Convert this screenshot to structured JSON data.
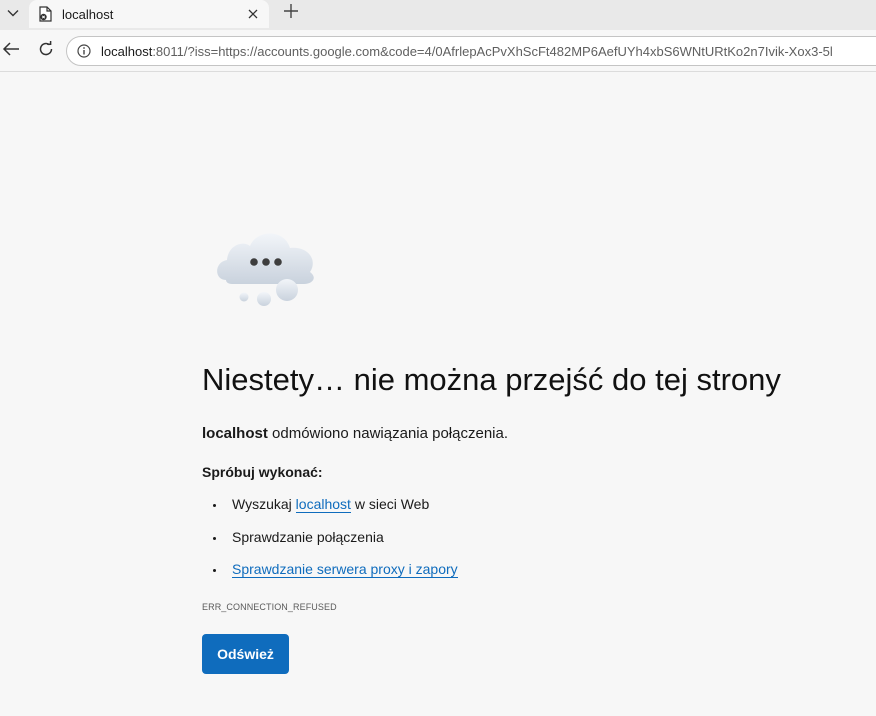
{
  "browser": {
    "tab": {
      "title": "localhost"
    },
    "address": {
      "host": "localhost",
      "rest": ":8011/?iss=https://accounts.google.com&code=4/0AfrlepAcPvXhScFt482MP6AefUYh4xbS6WNtURtKo2n7Ivik-Xox3-5l"
    },
    "icons": {
      "tab_menu": "chevron-down-icon",
      "favicon": "page-error-icon",
      "tab_close": "close-icon",
      "new_tab": "plus-icon",
      "back": "arrow-left-icon",
      "reload": "reload-icon",
      "info": "info-icon"
    }
  },
  "error_page": {
    "illustration": "cloud-icon",
    "headline": "Niestety… nie można przejść do tej strony",
    "description": {
      "host": "localhost",
      "message": " odmówiono nawiązania połączenia."
    },
    "try_title": "Spróbuj wykonać:",
    "suggestions": [
      {
        "before": "Wyszukaj ",
        "link": "localhost",
        "after": " w sieci Web"
      },
      {
        "text": "Sprawdzanie połączenia"
      },
      {
        "link": "Sprawdzanie serwera proxy i zapory"
      }
    ],
    "error_code": "ERR_CONNECTION_REFUSED",
    "refresh_label": "Odśwież"
  },
  "colors": {
    "accent": "#0f6cbd",
    "page_background": "#f7f7f7",
    "tabstrip": "#e9e9e9"
  }
}
